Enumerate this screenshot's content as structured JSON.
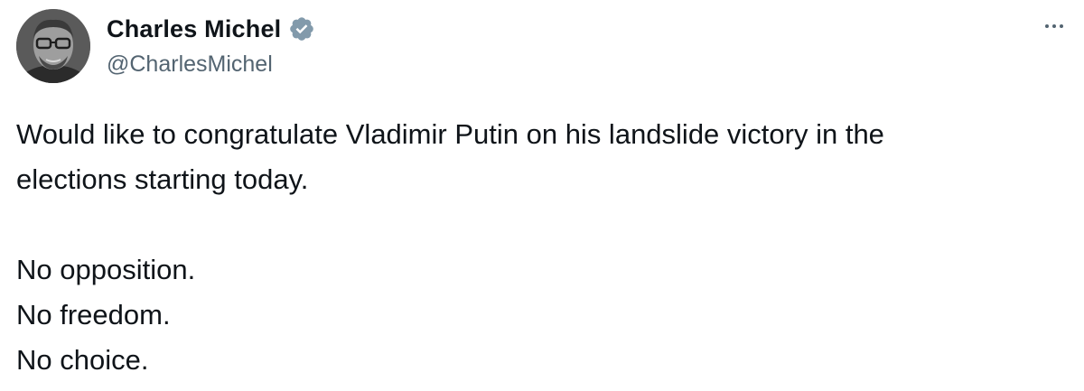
{
  "author": {
    "display_name": "Charles Michel",
    "handle": "@CharlesMichel",
    "verified_icon": "verified-badge-icon",
    "avatar_icon": "profile-photo"
  },
  "more_menu": {
    "icon": "more-horizontal-icon"
  },
  "tweet": {
    "lines": [
      "Would like to congratulate Vladimir Putin on his landslide victory in the",
      "elections starting today."
    ],
    "closing_lines": [
      "No opposition.",
      "No freedom.",
      "No choice."
    ]
  },
  "colors": {
    "text_primary": "#0f1419",
    "text_secondary": "#536471",
    "verified_badge": "#829aab"
  }
}
